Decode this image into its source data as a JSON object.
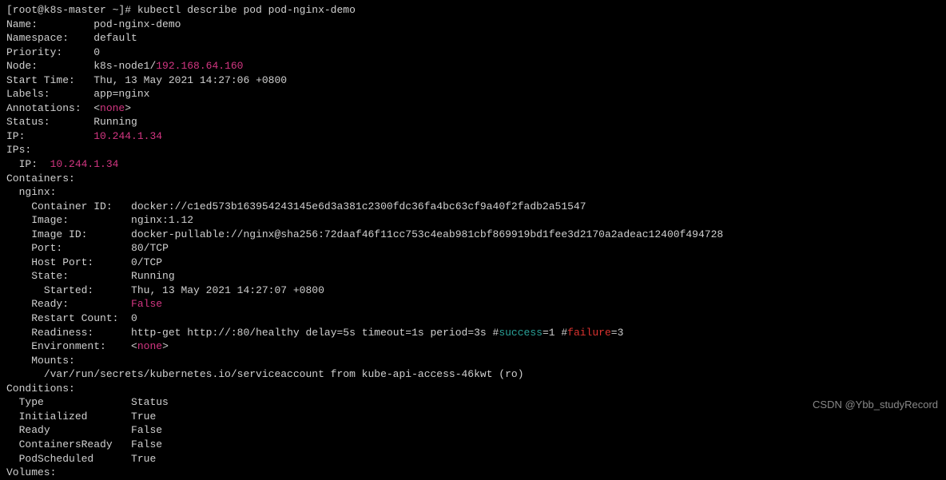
{
  "prompt": "[root@k8s-master ~]# ",
  "command": "kubectl describe pod pod-nginx-demo",
  "pod": {
    "name": "pod-nginx-demo",
    "namespace": "default",
    "priority": "0",
    "node_name": "k8s-node1/",
    "node_ip": "192.168.64.160",
    "start_time": "Thu, 13 May 2021 14:27:06 +0800",
    "labels": "app=nginx",
    "annotations": "none",
    "status": "Running",
    "ip": "10.244.1.34",
    "ips_ip": "10.244.1.34"
  },
  "container": {
    "name": "nginx:",
    "id": "docker://c1ed573b163954243145e6d3a381c2300fdc36fa4bc63cf9a40f2fadb2a51547",
    "image": "nginx:1.12",
    "image_id": "docker-pullable://nginx@sha256:72daaf46f11cc753c4eab981cbf869919bd1fee3d2170a2adeac12400f494728",
    "port": "80/TCP",
    "host_port": "0/TCP",
    "state": "Running",
    "started": "Thu, 13 May 2021 14:27:07 +0800",
    "ready": "False",
    "restart_count": "0",
    "readiness_pre": "http-get http://:80/healthy delay=5s timeout=1s period=3s #",
    "readiness_success_word": "success",
    "readiness_mid": "=1 #",
    "readiness_failure_word": "failure",
    "readiness_post": "=3",
    "environment": "none",
    "mounts_path": "/var/run/secrets/kubernetes.io/serviceaccount from kube-api-access-46kwt (ro)"
  },
  "labels_txt": {
    "name": "Name:",
    "namespace": "Namespace:",
    "priority": "Priority:",
    "node": "Node:",
    "start_time": "Start Time:",
    "labels": "Labels:",
    "annotations": "Annotations:",
    "status": "Status:",
    "ip": "IP:",
    "ips": "IPs:",
    "ips_ip": "IP:",
    "containers": "Containers:",
    "container_id": "Container ID:",
    "image": "Image:",
    "image_id": "Image ID:",
    "port": "Port:",
    "host_port": "Host Port:",
    "state": "State:",
    "started": "Started:",
    "ready": "Ready:",
    "restart_count": "Restart Count:",
    "readiness": "Readiness:",
    "environment": "Environment:",
    "mounts": "Mounts:",
    "conditions": "Conditions:",
    "type": "Type",
    "status_col": "Status",
    "volumes": "Volumes:"
  },
  "conditions": {
    "initialized": {
      "type": "Initialized",
      "status": "True"
    },
    "ready": {
      "type": "Ready",
      "status": "False"
    },
    "containers_ready": {
      "type": "ContainersReady",
      "status": "False"
    },
    "pod_scheduled": {
      "type": "PodScheduled",
      "status": "True"
    }
  },
  "watermark": "CSDN @Ybb_studyRecord"
}
